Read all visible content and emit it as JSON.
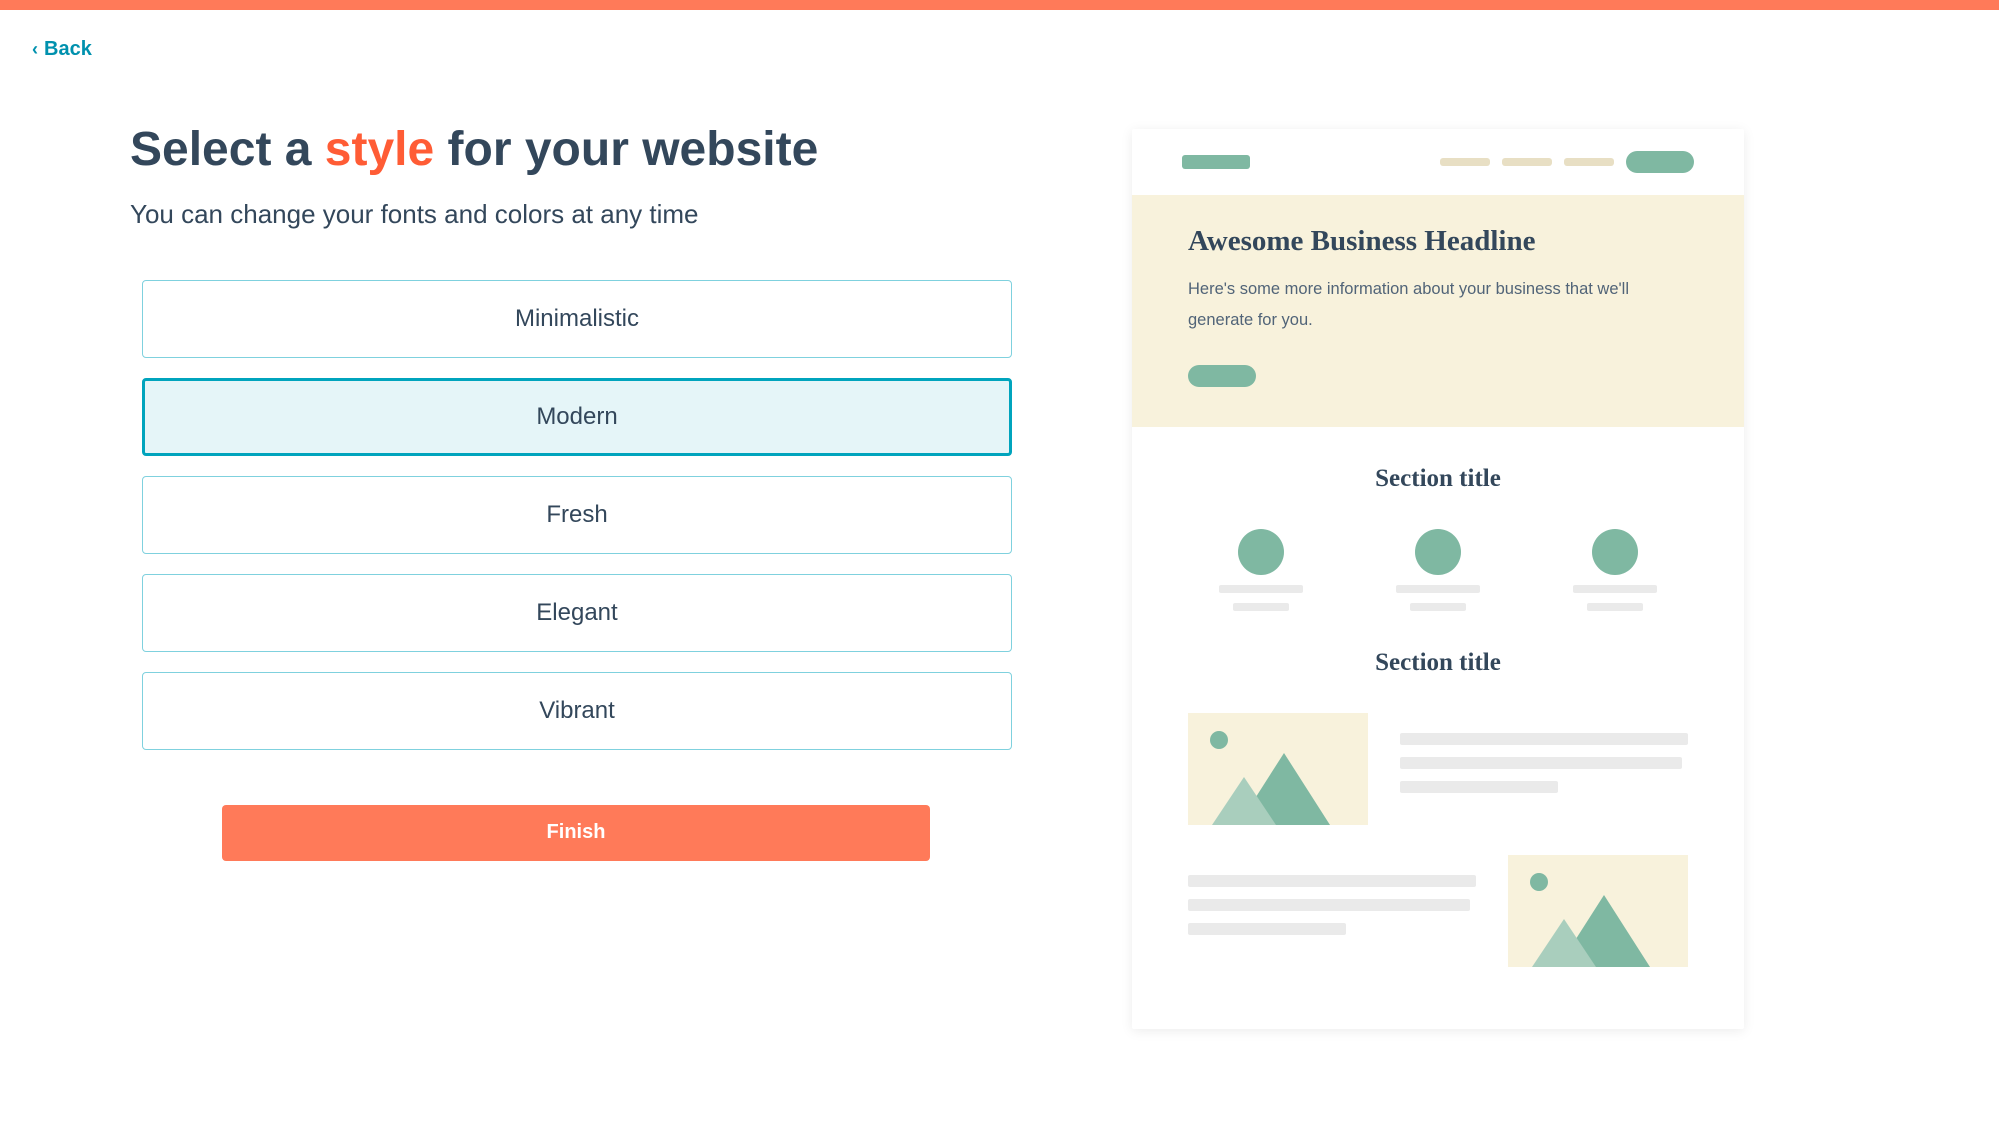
{
  "back_label": "Back",
  "page_title": {
    "prefix": "Select a ",
    "highlight": "style",
    "suffix": " for your website"
  },
  "subtitle": "You can change your fonts and colors at any time",
  "style_options": [
    {
      "label": "Minimalistic",
      "selected": false
    },
    {
      "label": "Modern",
      "selected": true
    },
    {
      "label": "Fresh",
      "selected": false
    },
    {
      "label": "Elegant",
      "selected": false
    },
    {
      "label": "Vibrant",
      "selected": false
    }
  ],
  "finish_label": "Finish",
  "preview": {
    "headline": "Awesome Business Headline",
    "subtext": "Here's some more information about your business that we'll generate for you.",
    "section_title_1": "Section title",
    "section_title_2": "Section title"
  },
  "colors": {
    "accent": "#ff7a59",
    "highlight": "#ff5c35",
    "link": "#0091ae",
    "option_border": "#7fd1de",
    "option_selected_bg": "#e5f5f8",
    "option_selected_border": "#00a4bd",
    "preview_green": "#7fb8a2",
    "preview_cream": "#f8f2dc",
    "text_dark": "#33475b"
  }
}
